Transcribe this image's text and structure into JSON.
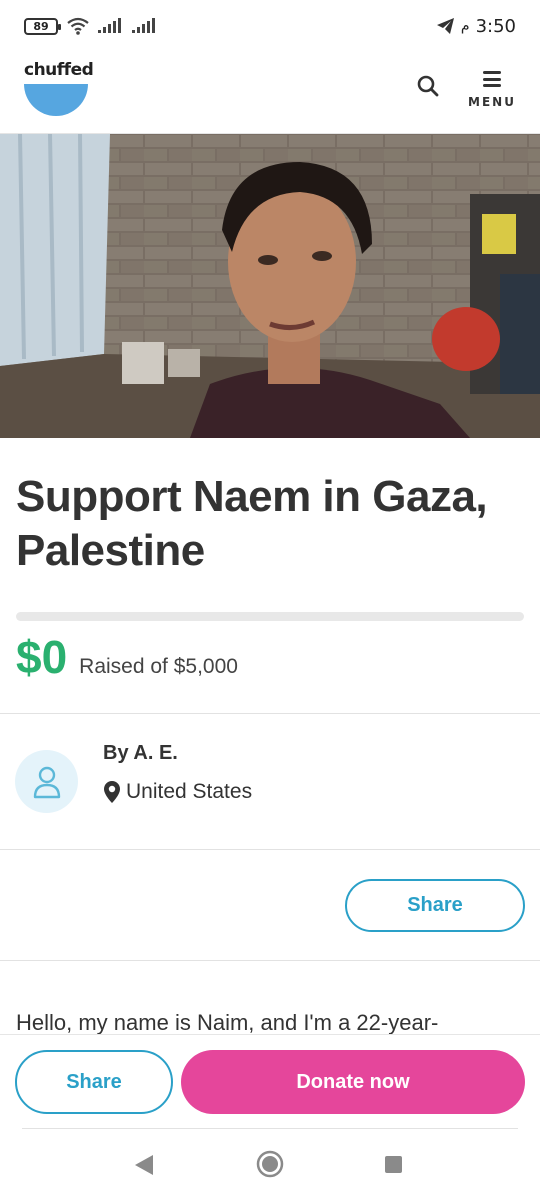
{
  "status_bar": {
    "battery": "89",
    "time": "3:50",
    "ampm": "م",
    "icons": [
      "wifi-icon",
      "signal-icon",
      "signal-icon",
      "telegram-icon"
    ]
  },
  "header": {
    "logo_text": "chuffed",
    "menu_label": "MENU",
    "logo_color": "#56a6e0"
  },
  "campaign": {
    "title": "Support Naem in Gaza, Palestine",
    "raised_amount": "$0",
    "raised_of": "Raised of $5,000",
    "progress_percent": 0,
    "organizer": "By A. E.",
    "location": "United States"
  },
  "share_label": "Share",
  "story_preview": "Hello, my name is Naim, and I'm a 22-year-",
  "actions": {
    "share_label": "Share",
    "donate_label": "Donate now"
  },
  "colors": {
    "accent_green": "#2ab06f",
    "accent_blue": "#2aa0c8",
    "donate_pink": "#e5469b"
  }
}
